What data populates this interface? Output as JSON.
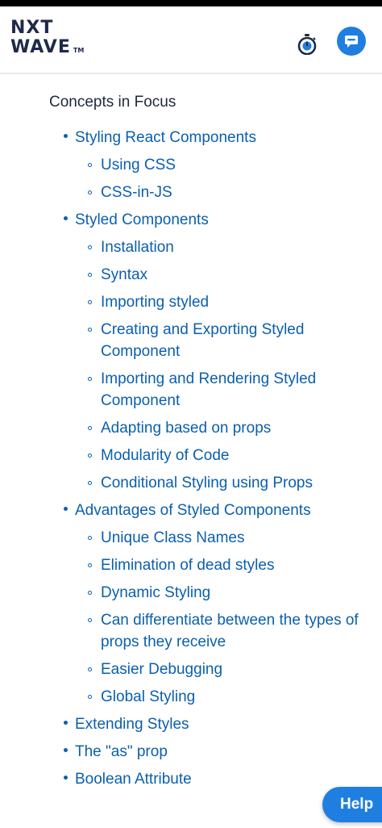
{
  "header": {
    "logo_line1": "NXT",
    "logo_line2": "WAVE",
    "logo_tm": "TM",
    "timer_icon": "stopwatch-icon",
    "chat_icon": "chat-bubble-icon"
  },
  "section_title": "Concepts in Focus",
  "topics": [
    {
      "label": "Styling React Components",
      "subs": [
        "Using CSS",
        "CSS-in-JS"
      ]
    },
    {
      "label": "Styled Components",
      "subs": [
        "Installation",
        "Syntax",
        "Importing styled",
        "Creating and Exporting Styled Component",
        "Importing and Rendering Styled Component",
        "Adapting based on props",
        "Modularity of Code",
        "Conditional Styling using Props"
      ]
    },
    {
      "label": "Advantages of Styled Components",
      "subs": [
        "Unique Class Names",
        "Elimination of dead styles",
        "Dynamic Styling",
        "Can differentiate between the types of props they receive",
        "Easier Debugging",
        "Global Styling"
      ]
    },
    {
      "label": "Extending Styles",
      "subs": []
    },
    {
      "label": "The \"as\" prop",
      "subs": []
    },
    {
      "label": "Boolean Attribute",
      "subs": []
    }
  ],
  "help_label": "Help",
  "colors": {
    "link": "#0b5fae",
    "accent": "#1f7fe0",
    "logo": "#1e2a4a"
  }
}
